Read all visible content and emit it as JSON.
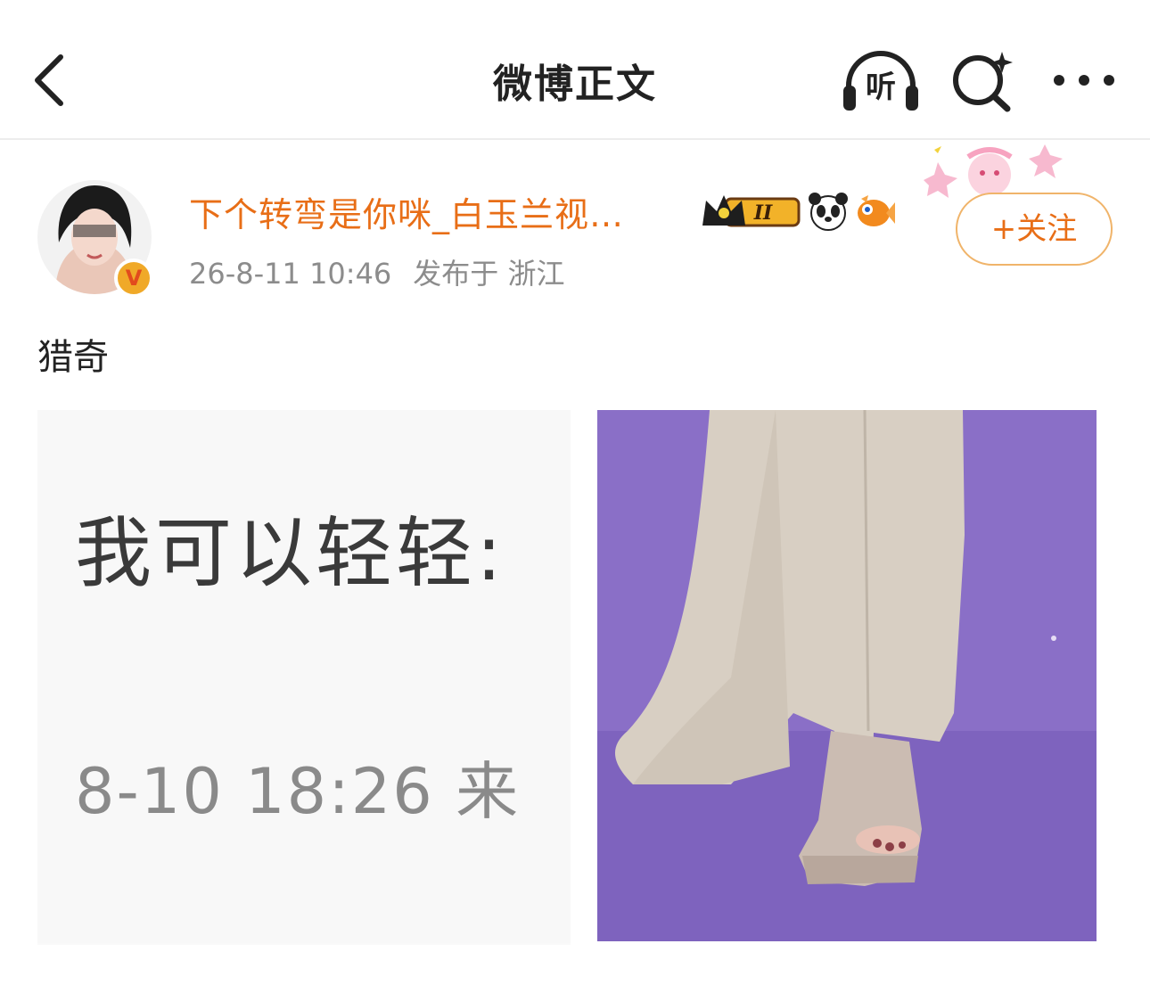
{
  "navbar": {
    "title": "微博正文",
    "listen_label": "听",
    "back_icon": "chevron-left-icon",
    "search_icon": "search-sparkle-icon",
    "more_icon": "more-dots-icon"
  },
  "post": {
    "author": "下个转弯是你咪_白玉兰视…",
    "timestamp": "26-8-11 10:46",
    "location": "发布于 浙江",
    "follow_label": "+关注",
    "text": "猎奇",
    "badges": [
      "crown-level-badge",
      "panda-icon",
      "goldfish-icon"
    ],
    "level_badge_text": "II"
  },
  "media": {
    "left_image": {
      "line1": "我可以轻轻:",
      "line2": "8-10 18:26 来"
    },
    "right_image": {
      "description_icon": "photo-purple-carpet"
    }
  },
  "colors": {
    "accent": "#e86e17",
    "follow_border": "#f0b46a",
    "carpet": "#8a6fc7",
    "dress": "#d8cfc3"
  }
}
